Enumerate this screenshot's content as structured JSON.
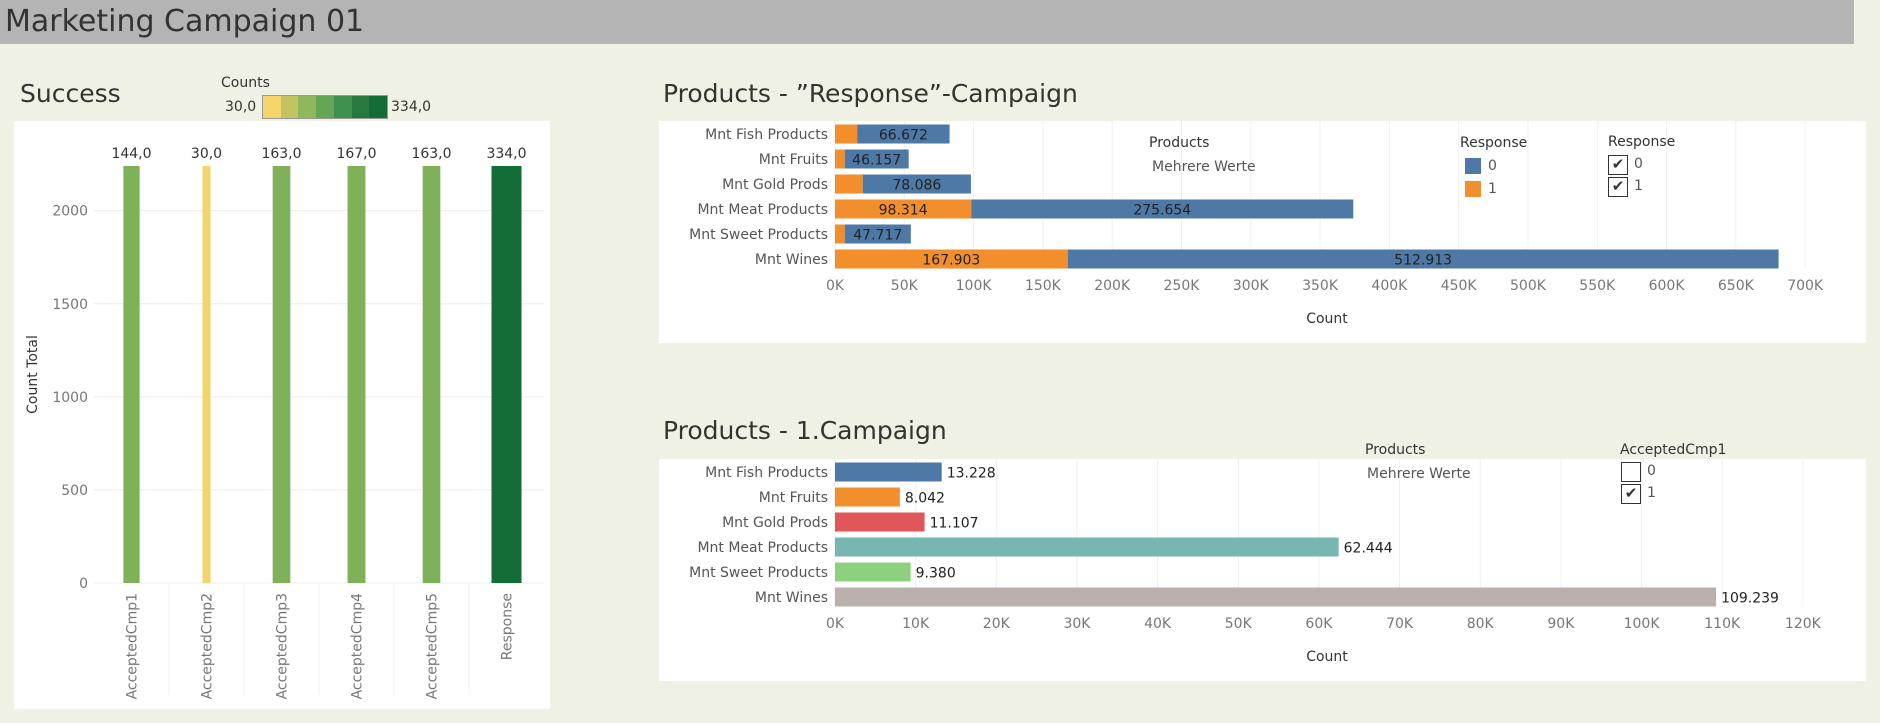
{
  "dashboard": {
    "title": "Marketing Campaign 01"
  },
  "success": {
    "title": "Success",
    "color_legend": {
      "title": "Counts",
      "min_label": "30,0",
      "max_label": "334,0",
      "colors": [
        "#f5d46a",
        "#c3c45f",
        "#8fb85a",
        "#63a756",
        "#3f9150",
        "#27793f",
        "#136d36"
      ]
    }
  },
  "chart_data": [
    {
      "type": "bar",
      "title": "Success",
      "ylabel": "Count Total",
      "categories": [
        "AcceptedCmp1",
        "AcceptedCmp2",
        "AcceptedCmp3",
        "AcceptedCmp4",
        "AcceptedCmp5",
        "Response"
      ],
      "values": [
        2240,
        2240,
        2240,
        2240,
        2240,
        2240
      ],
      "data_labels": [
        "144,0",
        "30,0",
        "163,0",
        "167,0",
        "163,0",
        "334,0"
      ],
      "counts": [
        144,
        30,
        163,
        167,
        163,
        334
      ],
      "bar_colors": [
        "#7fb258",
        "#f3d36b",
        "#7fb258",
        "#7fb258",
        "#7fb258",
        "#136d36"
      ],
      "ylim": [
        0,
        2240
      ],
      "yticks": [
        0,
        500,
        1000,
        1500,
        2000
      ],
      "ytick_labels": [
        "0",
        "500",
        "1000",
        "1500",
        "2000"
      ],
      "grid": true
    },
    {
      "type": "bar",
      "orientation": "horizontal",
      "stacked": true,
      "title": "Products - ”Response”-Campaign",
      "xlabel": "Count",
      "categories": [
        "Mnt Fish Products",
        "Mnt Fruits",
        "Mnt Gold Prods",
        "Mnt Meat Products",
        "Mnt Sweet Products",
        "Mnt Wines"
      ],
      "series": [
        {
          "name": "1",
          "color": "#f28e2b",
          "values": [
            16000,
            7000,
            20000,
            98314,
            7000,
            167903
          ],
          "labels": [
            "",
            "",
            "",
            "98.314",
            "",
            "167.903"
          ]
        },
        {
          "name": "0",
          "color": "#4e79a7",
          "values": [
            66672,
            46157,
            78086,
            275654,
            47717,
            512913
          ],
          "labels": [
            "66.672",
            "46.157",
            "78.086",
            "275.654",
            "47.717",
            "512.913"
          ]
        }
      ],
      "xlim": [
        0,
        710000
      ],
      "xticks": [
        0,
        50000,
        100000,
        150000,
        200000,
        250000,
        300000,
        350000,
        400000,
        450000,
        500000,
        550000,
        600000,
        650000,
        700000
      ],
      "xtick_labels": [
        "0K",
        "50K",
        "100K",
        "150K",
        "200K",
        "250K",
        "300K",
        "350K",
        "400K",
        "450K",
        "500K",
        "550K",
        "600K",
        "650K",
        "700K"
      ],
      "grid": true
    },
    {
      "type": "bar",
      "orientation": "horizontal",
      "title": "Products - 1.Campaign",
      "xlabel": "Count",
      "categories": [
        "Mnt Fish Products",
        "Mnt Fruits",
        "Mnt Gold Prods",
        "Mnt Meat Products",
        "Mnt Sweet Products",
        "Mnt Wines"
      ],
      "values": [
        13228,
        8042,
        11107,
        62444,
        9380,
        109239
      ],
      "data_labels": [
        "13.228",
        "8.042",
        "11.107",
        "62.444",
        "9.380",
        "109.239"
      ],
      "bar_colors": [
        "#4e79a7",
        "#f28e2b",
        "#e15759",
        "#76b7b2",
        "#8cd17d",
        "#bab0ac"
      ],
      "xlim": [
        0,
        122000
      ],
      "xticks": [
        0,
        10000,
        20000,
        30000,
        40000,
        50000,
        60000,
        70000,
        80000,
        90000,
        100000,
        110000,
        120000
      ],
      "xtick_labels": [
        "0K",
        "10K",
        "20K",
        "30K",
        "40K",
        "50K",
        "60K",
        "70K",
        "80K",
        "90K",
        "100K",
        "110K",
        "120K"
      ],
      "grid": true
    }
  ],
  "response_panel": {
    "products_filter": {
      "title": "Products",
      "value": "Mehrere Werte"
    },
    "color_legend": {
      "title": "Response",
      "items": [
        {
          "label": "0",
          "color": "#4e79a7"
        },
        {
          "label": "1",
          "color": "#f28e2b"
        }
      ]
    },
    "filter": {
      "title": "Response",
      "items": [
        {
          "label": "0",
          "checked": true
        },
        {
          "label": "1",
          "checked": true
        }
      ]
    }
  },
  "campaign_panel": {
    "products_filter": {
      "title": "Products",
      "value": "Mehrere Werte"
    },
    "filter": {
      "title": "AcceptedCmp1",
      "items": [
        {
          "label": "0",
          "checked": false
        },
        {
          "label": "1",
          "checked": true
        }
      ]
    }
  }
}
